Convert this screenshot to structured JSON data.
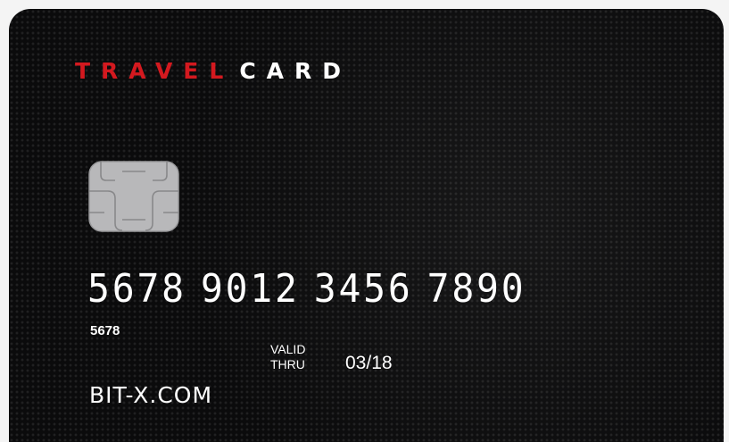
{
  "card": {
    "brand_word_1": "TRAVEL",
    "brand_word_2": "CARD",
    "number_groups": [
      "5678",
      "9012",
      "3456",
      "7890"
    ],
    "short_number": "5678",
    "valid_label_1": "VALID",
    "valid_label_2": "THRU",
    "expiry": "03/18",
    "website": "BIT-X.COM",
    "chip_icon": "chip-icon",
    "colors": {
      "card_background": "#0b0b0c",
      "brand_red": "#d3191f",
      "text": "#ffffff",
      "chip": "#b9b9bb"
    }
  }
}
